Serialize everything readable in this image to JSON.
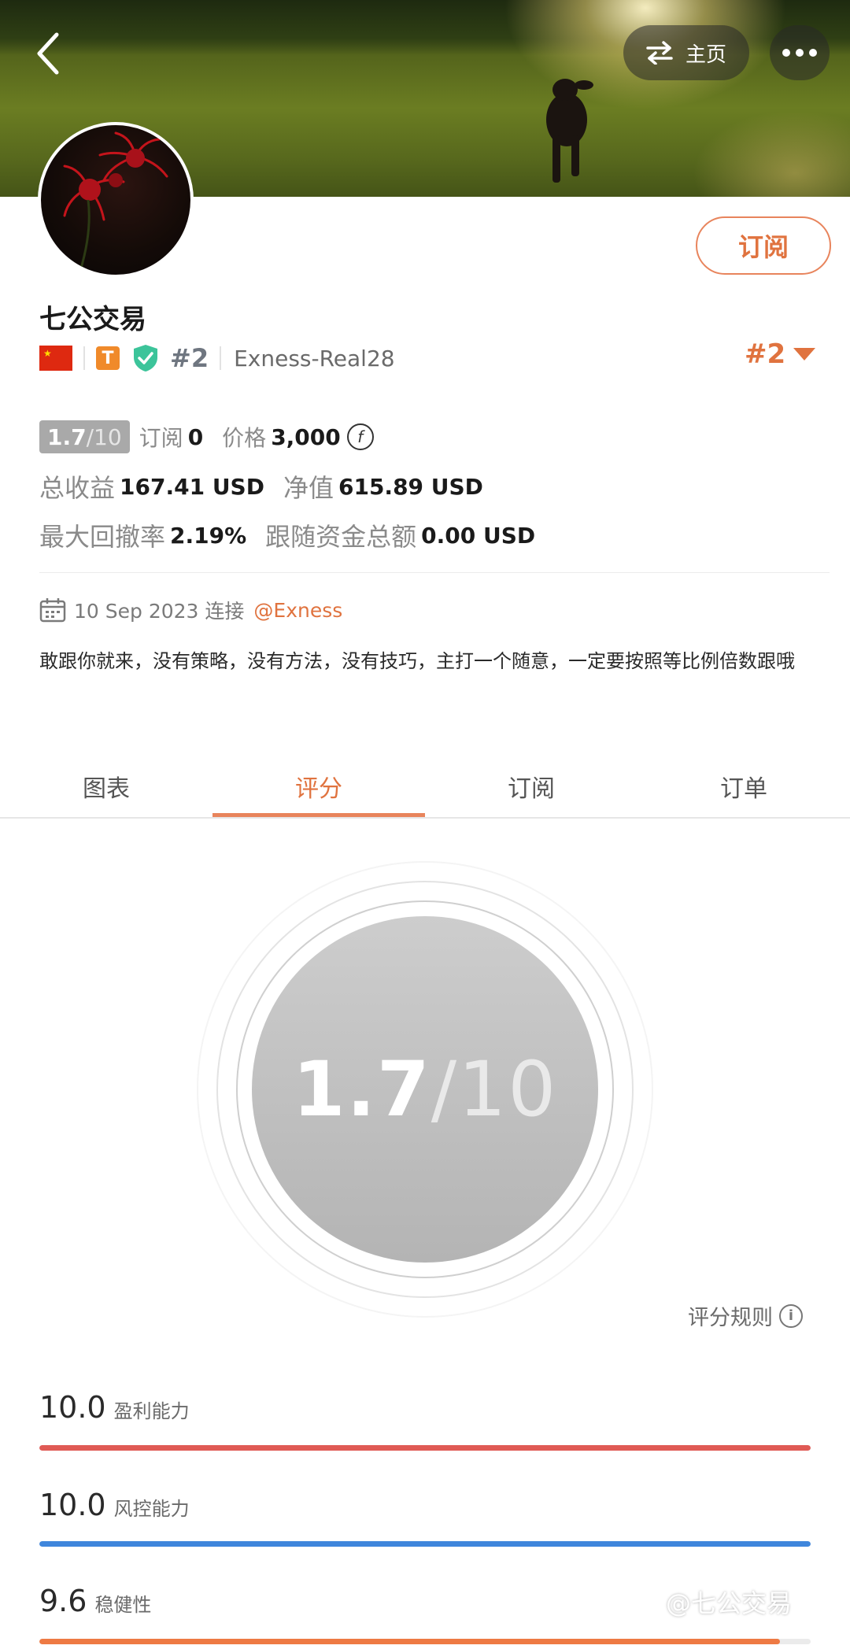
{
  "header": {
    "home_label": "主页"
  },
  "profile": {
    "name": "七公交易",
    "rank_inline": "#2",
    "server": "Exness-Real28",
    "rank_right": "#2",
    "subscribe_label": "订阅",
    "t_badge": "T"
  },
  "stats": {
    "score_num": "1.7",
    "score_den": "/10",
    "subs_label": "订阅",
    "subs_value": "0",
    "price_label": "价格",
    "price_value": "3,000",
    "coin_symbol": "f",
    "total_profit_label": "总收益",
    "total_profit_value": "167.41 USD",
    "equity_label": "净值",
    "equity_value": "615.89 USD",
    "max_drawdown_label": "最大回撤率",
    "max_drawdown_value": "2.19%",
    "follow_funds_label": "跟随资金总额",
    "follow_funds_value": "0.00 USD"
  },
  "connect": {
    "date": "10 Sep 2023 连接",
    "broker": "@Exness"
  },
  "bio": "敢跟你就来，没有策略，没有方法，没有技巧，主打一个随意，一定要按照等比例倍数跟哦",
  "tabs": [
    {
      "label": "图表"
    },
    {
      "label": "评分"
    },
    {
      "label": "订阅"
    },
    {
      "label": "订单"
    }
  ],
  "active_tab": 1,
  "score_circle": {
    "num": "1.7",
    "den": "/10"
  },
  "rules_label": "评分规则",
  "metrics": [
    {
      "value": "10.0",
      "label": "盈利能力",
      "fill": 1.0,
      "color": "#e05a55"
    },
    {
      "value": "10.0",
      "label": "风控能力",
      "fill": 1.0,
      "color": "#3f86dc"
    },
    {
      "value": "9.6",
      "label": "稳健性",
      "fill": 0.96,
      "color": "#ee7a44"
    }
  ],
  "watermark": "@七公交易",
  "colors": {
    "accent": "#e0733f",
    "score_grey": "#a9a9a9"
  }
}
